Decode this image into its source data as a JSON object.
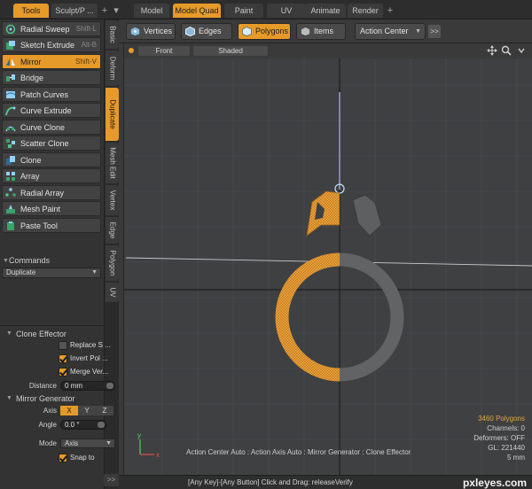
{
  "left_tabs": [
    {
      "label": "Tools",
      "active": true
    },
    {
      "label": "Sculpt/P ...",
      "active": false
    }
  ],
  "main_tabs": [
    {
      "label": "Model",
      "active": false
    },
    {
      "label": "Model Quad",
      "active": true
    },
    {
      "label": "Paint",
      "active": false
    },
    {
      "label": "UV",
      "active": false
    },
    {
      "label": "Animate",
      "active": false
    },
    {
      "label": "Render",
      "active": false
    }
  ],
  "tools": [
    {
      "label": "Radial Sweep",
      "shortcut": "Shift-L",
      "icon": "radial-sweep-icon",
      "active": false
    },
    {
      "label": "Sketch Extrude",
      "shortcut": "Alt-B",
      "icon": "sketch-extrude-icon",
      "active": false
    },
    {
      "label": "Mirror",
      "shortcut": "Shift-V",
      "icon": "mirror-icon",
      "active": true
    },
    {
      "label": "Bridge",
      "shortcut": "",
      "icon": "bridge-icon",
      "active": false
    },
    {
      "label": "Patch Curves",
      "shortcut": "",
      "icon": "patch-curves-icon",
      "active": false
    },
    {
      "label": "Curve Extrude",
      "shortcut": "",
      "icon": "curve-extrude-icon",
      "active": false
    },
    {
      "label": "Curve Clone",
      "shortcut": "",
      "icon": "curve-clone-icon",
      "active": false
    },
    {
      "label": "Scatter Clone",
      "shortcut": "",
      "icon": "scatter-clone-icon",
      "active": false
    },
    {
      "label": "Clone",
      "shortcut": "",
      "icon": "clone-icon",
      "active": false
    },
    {
      "label": "Array",
      "shortcut": "",
      "icon": "array-icon",
      "active": false
    },
    {
      "label": "Radial Array",
      "shortcut": "",
      "icon": "radial-array-icon",
      "active": false
    },
    {
      "label": "Mesh Paint",
      "shortcut": "",
      "icon": "mesh-paint-icon",
      "active": false
    },
    {
      "label": "Paste Tool",
      "shortcut": "",
      "icon": "paste-tool-icon",
      "active": false
    }
  ],
  "commands": {
    "header": "Commands",
    "selected": "Duplicate"
  },
  "side_tabs": [
    {
      "label": "Basic",
      "active": false
    },
    {
      "label": "Deform",
      "active": false
    },
    {
      "label": "Duplicate",
      "active": true
    },
    {
      "label": "Mesh Edit",
      "active": false
    },
    {
      "label": "Vertex",
      "active": false
    },
    {
      "label": "Edge",
      "active": false
    },
    {
      "label": "Polygon",
      "active": false
    },
    {
      "label": "UV",
      "active": false
    }
  ],
  "clone_effector": {
    "header": "Clone Effector",
    "replace_label": "Replace S ...",
    "replace_checked": false,
    "invert_label": "Invert Pol ...",
    "invert_checked": true,
    "merge_label": "Merge Ver...",
    "merge_checked": true,
    "distance_label": "Distance",
    "distance_value": "0 mm"
  },
  "mirror_generator": {
    "header": "Mirror Generator",
    "axis_label": "Axis",
    "axis_options": [
      "X",
      "Y",
      "Z"
    ],
    "axis_selected": "X",
    "angle_label": "Angle",
    "angle_value": "0.0 °",
    "mode_label": "Mode",
    "mode_value": "Axis",
    "snap_label": "Snap to",
    "snap_checked": true
  },
  "mode_toolbar": {
    "vertices": "Vertices",
    "edges": "Edges",
    "polygons": "Polygons",
    "items": "Items",
    "action_center": "Action Center",
    "more": ">>",
    "active": "Polygons"
  },
  "viewport": {
    "view_label": "Front",
    "shading_label": "Shaded",
    "info_line": "Action Center Auto : Action Axis Auto : Mirror Generator : Clone Effector",
    "stats": {
      "polygons": "3460 Polygons",
      "channels": "Channels: 0",
      "deformers": "Deformers: OFF",
      "gl": "GL: 221440",
      "unit": "5 mm"
    },
    "axis_y": "y",
    "axis_x": "x"
  },
  "colors": {
    "accent": "#e69a2a",
    "ring_selected": "#e8a13a",
    "ring_mirror": "#6a6a6a"
  },
  "status_bar": {
    "text": "[Any Key]-[Any Button] Click and Drag:  releaseVerify",
    "watermark": "pxleyes.com",
    "expand": ">>"
  }
}
